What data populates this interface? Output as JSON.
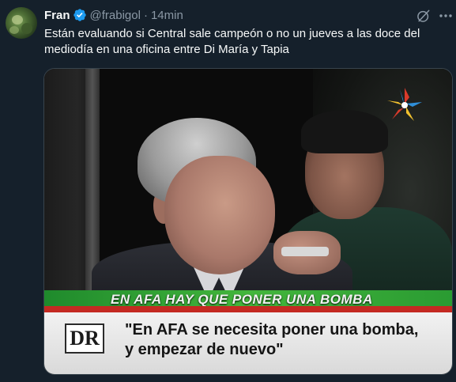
{
  "author": {
    "display_name": "Fran",
    "handle": "@frabigol",
    "separator": "·",
    "timestamp": "14min"
  },
  "tweet": {
    "text": "Están evaluando si Central sale campeón o no un jueves a las doce del mediodía en una oficina entre Di María y Tapia"
  },
  "media": {
    "banner_text": "EN AFA HAY QUE PONER UNA BOMBA",
    "logo_text": "DR",
    "quote_line1": "\"En AFA se necesita poner una bomba,",
    "quote_line2": "y empezar de nuevo\""
  },
  "icons": {
    "verified": "verified-badge-icon",
    "grok": "grok-icon",
    "more": "more-options-icon"
  },
  "colors": {
    "background": "#15202b",
    "text_primary": "#f7f9f9",
    "text_secondary": "#8b98a5",
    "verified_blue": "#1d9bf0",
    "banner_green": "#43b63c",
    "banner_red": "#c42a22"
  }
}
